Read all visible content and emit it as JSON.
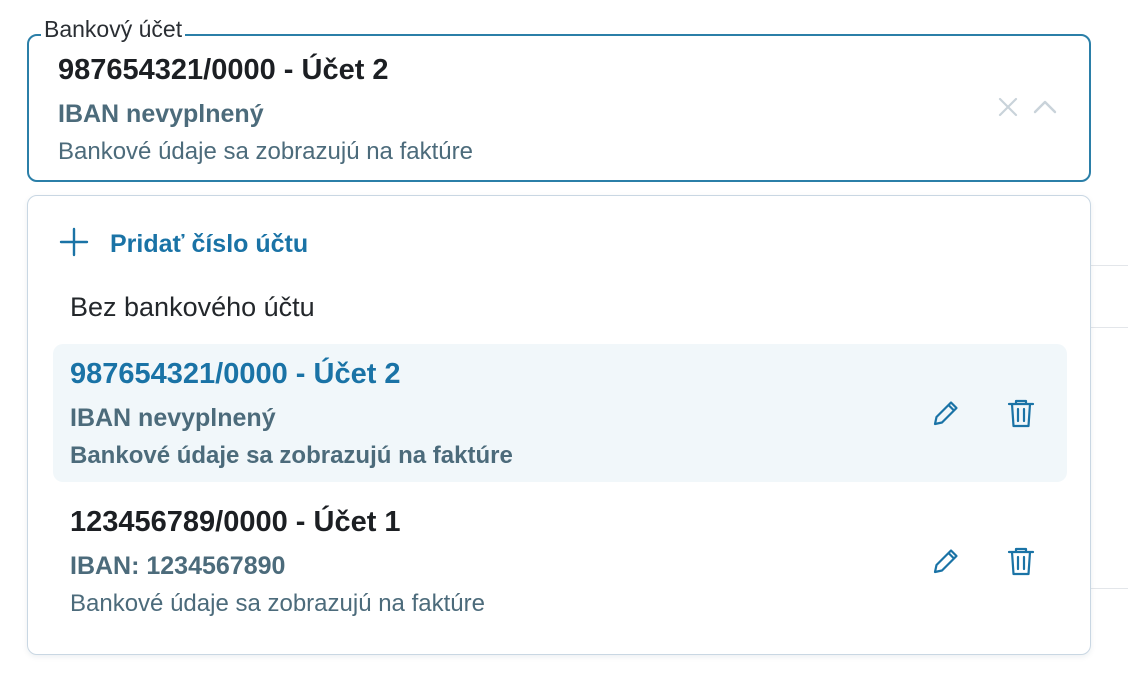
{
  "field": {
    "label": "Bankový účet",
    "selected_title": "987654321/0000 - Účet 2",
    "selected_iban": "IBAN nevyplnený",
    "selected_note": "Bankové údaje sa zobrazujú na faktúre",
    "clear_icon": "close-icon",
    "toggle_icon": "chevron-up-icon"
  },
  "dropdown": {
    "add_label": "Pridať číslo účtu",
    "add_icon": "plus-icon",
    "no_account_label": "Bez bankového účtu",
    "options": [
      {
        "title": "987654321/0000 - Účet 2",
        "iban": "IBAN nevyplnený",
        "note": "Bankové údaje sa zobrazujú na faktúre",
        "selected": true
      },
      {
        "title": "123456789/0000 - Účet 1",
        "iban": "IBAN: 1234567890",
        "note": "Bankové údaje sa zobrazujú na faktúre",
        "selected": false
      }
    ],
    "edit_icon": "pencil-icon",
    "delete_icon": "trash-icon"
  },
  "colors": {
    "accent": "#1a73a6",
    "border_focus": "#2b7fa8",
    "muted_text": "#4c6b7b",
    "selected_bg": "#f1f7fa"
  }
}
